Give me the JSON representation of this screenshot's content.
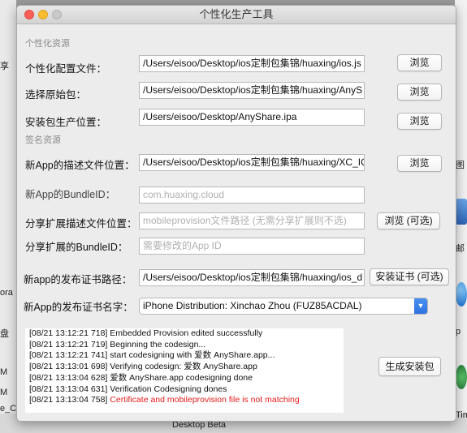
{
  "window": {
    "title": "个性化生产工具"
  },
  "background": {
    "left_fragments": [
      "享",
      "ora",
      "盘",
      "M",
      "M",
      "e_C"
    ],
    "right_fragments": [
      "图",
      "邮",
      "p",
      "Tim"
    ],
    "bottom_text": "Desktop Beta"
  },
  "sections": {
    "personal": "个性化资源",
    "signing": "签名资源"
  },
  "rows": [
    {
      "label": "个性化配置文件：",
      "value": "/Users/eisoo/Desktop/ios定制包集锦/huaxing/ios.js",
      "button": "浏览"
    },
    {
      "label": "选择原始包：",
      "value": "/Users/eisoo/Desktop/ios定制包集锦/huaxing/AnyS",
      "button": "浏览"
    },
    {
      "label": "安装包生产位置：",
      "value": "/Users/eisoo/Desktop/AnyShare.ipa",
      "button": "浏览"
    },
    {
      "label": "新App的描述文件位置：",
      "value": "/Users/eisoo/Desktop/ios定制包集锦/huaxing/XC_IO",
      "button": "浏览"
    },
    {
      "label": "新App的BundleID：",
      "placeholder": "com.huaxing.cloud"
    },
    {
      "label": "分享扩展描述文件位置：",
      "placeholder": "mobileprovision文件路径 (无需分享扩展则不选)",
      "button": "浏览 (可选)"
    },
    {
      "label": "分享扩展的BundleID：",
      "placeholder": "需要修改的App ID"
    },
    {
      "label": "新app的发布证书路径：",
      "value": "/Users/eisoo/Desktop/ios定制包集锦/huaxing/ios_d",
      "button": "安装证书 (可选)"
    },
    {
      "label": "新App的发布证书名字：",
      "select_value": "iPhone Distribution: Xinchao Zhou (FUZ85ACDAL)"
    }
  ],
  "log": [
    {
      "time": "[08/21 13:12:21 718]",
      "text": "Embedded Provision edited successfully",
      "error": false
    },
    {
      "time": "[08/21 13:12:21 719]",
      "text": "Beginning the codesign...",
      "error": false
    },
    {
      "time": "[08/21 13:12:21 741]",
      "text": "start codesigning with 爱数 AnyShare.app...",
      "error": false
    },
    {
      "time": "[08/21 13:13:01 698]",
      "text": "Verifying codesign: 爱数 AnyShare.app",
      "error": false
    },
    {
      "time": "[08/21 13:13:04 628]",
      "text": "爱数 AnyShare.app codesigning done",
      "error": false
    },
    {
      "time": "[08/21 13:13:04 631]",
      "text": "Verification Codesigning dones",
      "error": false
    },
    {
      "time": "[08/21 13:13:04 758]",
      "text": "Certificate and mobileprovision file is not matching",
      "error": true
    }
  ],
  "generate_button": "生成安装包",
  "colors": {
    "error_text": "#e81c1c",
    "select_accent": "#2f73e0"
  }
}
